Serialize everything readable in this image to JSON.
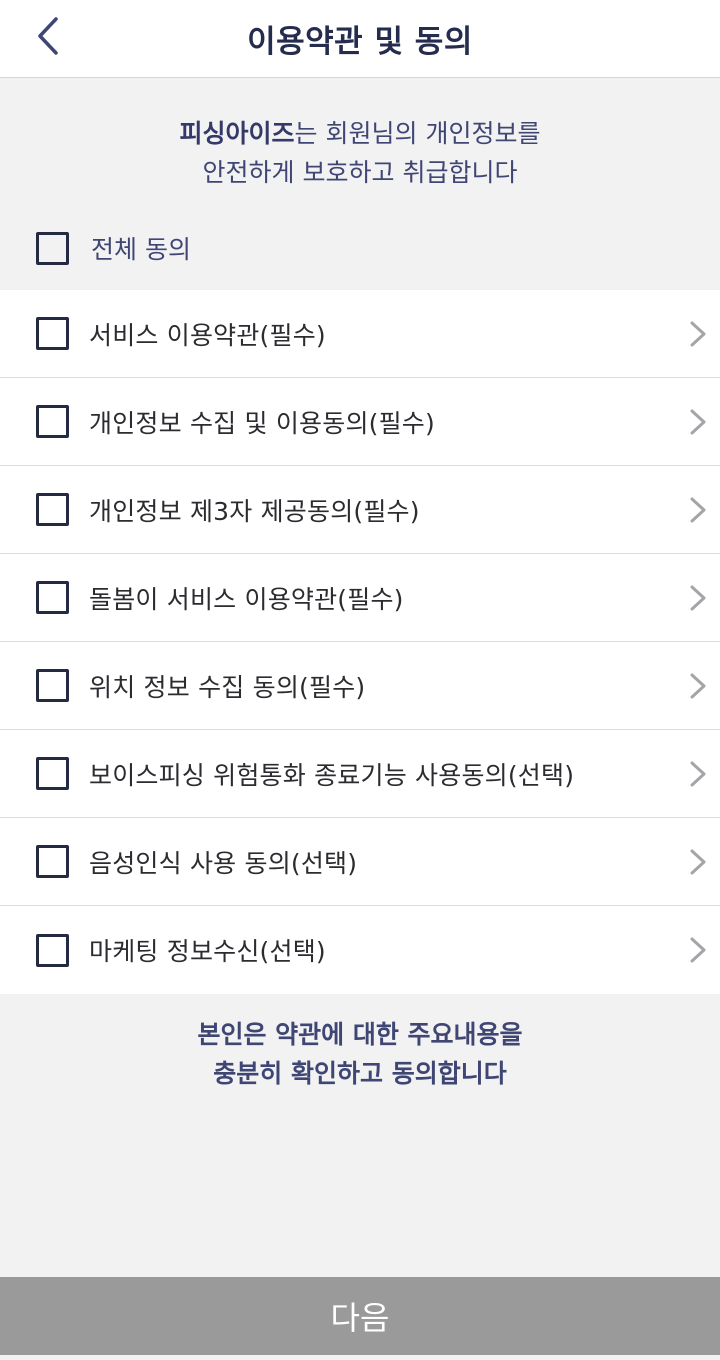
{
  "header": {
    "title": "이용약관 및 동의",
    "back_icon": "chevron-left-icon"
  },
  "intro": {
    "brand": "피싱아이즈",
    "line1_rest": "는 회원님의 개인정보를",
    "line2": "안전하게 보호하고 취급합니다"
  },
  "check_all": {
    "label": "전체 동의",
    "checked": false
  },
  "terms": [
    {
      "label": "서비스 이용약관(필수)",
      "checked": false
    },
    {
      "label": "개인정보 수집 및 이용동의(필수)",
      "checked": false
    },
    {
      "label": "개인정보 제3자 제공동의(필수)",
      "checked": false
    },
    {
      "label": "돌봄이 서비스 이용약관(필수)",
      "checked": false
    },
    {
      "label": "위치 정보 수집 동의(필수)",
      "checked": false
    },
    {
      "label": "보이스피싱 위험통화 종료기능 사용동의(선택)",
      "checked": false
    },
    {
      "label": "음성인식 사용 동의(선택)",
      "checked": false
    },
    {
      "label": "마케팅 정보수신(선택)",
      "checked": false
    }
  ],
  "statement": {
    "line1": "본인은 약관에 대한 주요내용을",
    "line2": "충분히 확인하고 동의합니다"
  },
  "next_button": {
    "label": "다음"
  },
  "colors": {
    "accent": "#3f4673",
    "title": "#262c4d",
    "checkbox": "#232a42",
    "button_disabled": "#9a9a9a",
    "background": "#f2f2f3",
    "chevron": "#a4a4a8"
  }
}
